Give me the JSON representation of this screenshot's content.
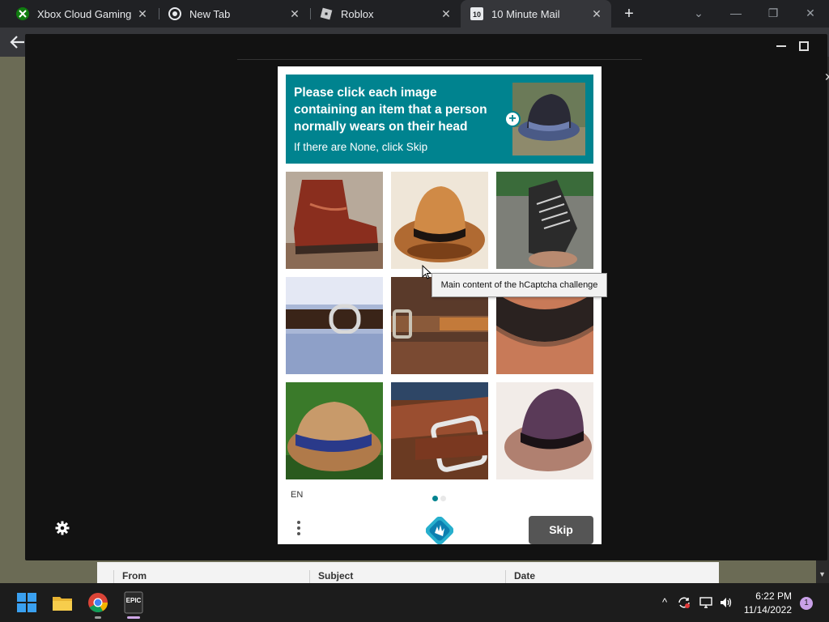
{
  "browser": {
    "tabs": [
      {
        "title": "Xbox Cloud Gaming (B",
        "icon": "xbox-icon",
        "active": false
      },
      {
        "title": "New Tab",
        "icon": "chrome-icon",
        "active": false
      },
      {
        "title": "Roblox",
        "icon": "roblox-icon",
        "active": false
      },
      {
        "title": "10 Minute Mail",
        "icon": "ten-minute-mail-icon",
        "active": true
      }
    ],
    "new_tab_symbol": "+",
    "tab_close_symbol": "✕",
    "window_controls": {
      "tab_search": "⌄",
      "minimize": "—",
      "restore": "❐",
      "close": "✕"
    }
  },
  "page": {
    "mail_table_headers": [
      "From",
      "Subject",
      "Date"
    ]
  },
  "overlay": {
    "close_symbol": "✕"
  },
  "captcha": {
    "prompt": "Please click each image containing an item that a person normally wears on their head",
    "subprompt": "If there are None, click Skip",
    "tiles": [
      {
        "name": "tile-1-boot"
      },
      {
        "name": "tile-2-hat"
      },
      {
        "name": "tile-3-sneaker"
      },
      {
        "name": "tile-4-belt"
      },
      {
        "name": "tile-5-belt-buckle"
      },
      {
        "name": "tile-6-belt-closeup"
      },
      {
        "name": "tile-7-straw-hat"
      },
      {
        "name": "tile-8-belt-buckle"
      },
      {
        "name": "tile-9-hat"
      }
    ],
    "language": "EN",
    "skip_label": "Skip",
    "tooltip": "Main content of the hCaptcha challenge",
    "colors": {
      "header": "#00838f",
      "skip": "#555555",
      "active_dot": "#00838f"
    }
  },
  "taskbar": {
    "apps": [
      "windows-start-icon",
      "file-explorer-icon",
      "chrome-icon",
      "epic-games-icon"
    ],
    "epic_label": "EPIC",
    "tray_up": "^",
    "clock_time": "6:22 PM",
    "clock_date": "11/14/2022",
    "notification_count": "1"
  }
}
